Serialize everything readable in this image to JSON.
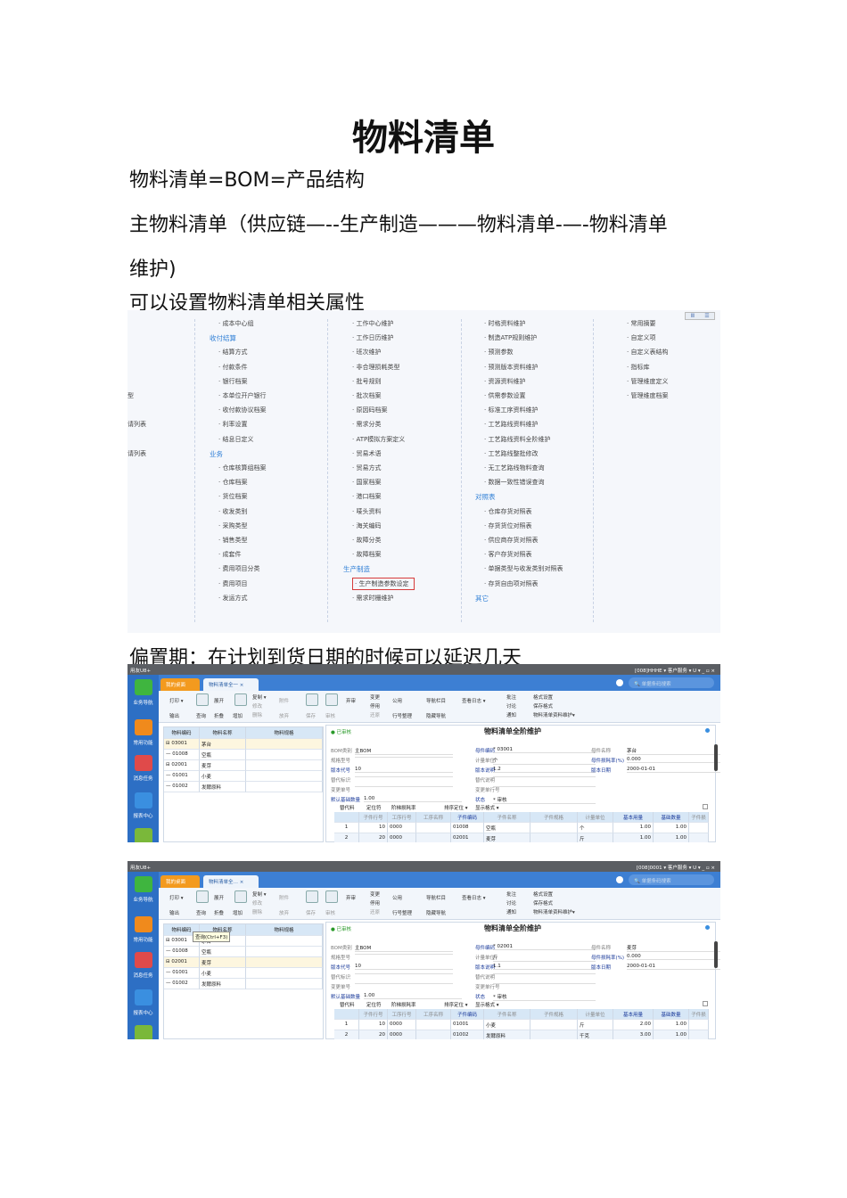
{
  "title": "物料清单",
  "paragraphs": [
    "物料清单=BOM=产品结构",
    "主物料清单（供应链—--生产制造———物料清单-—-物料清单",
    "维护)",
    "可以设置物料清单相关属性",
    "偏置期：在计划到货日期的时候可以延迟几天"
  ],
  "menu": {
    "view_toggle": [
      "Ⅲ",
      "☰"
    ],
    "columns": [
      {
        "items": [
          {
            "row": 5,
            "text": "型"
          },
          {
            "row": 7,
            "text": "请列表"
          },
          {
            "row": 9,
            "text": "请列表"
          }
        ]
      },
      {
        "items": [
          {
            "text": "成本中心组"
          },
          {
            "text": "收付结算",
            "header": true
          },
          {
            "text": "结算方式"
          },
          {
            "text": "付款条件"
          },
          {
            "text": "银行档案"
          },
          {
            "text": "本单位开户银行"
          },
          {
            "text": "收付款协议档案"
          },
          {
            "text": "利率设置"
          },
          {
            "text": "结息日定义"
          },
          {
            "text": "业务",
            "header": true
          },
          {
            "text": "仓库核算组档案"
          },
          {
            "text": "仓库档案"
          },
          {
            "text": "货位档案"
          },
          {
            "text": "收发类别"
          },
          {
            "text": "采购类型"
          },
          {
            "text": "销售类型"
          },
          {
            "text": "成套件"
          },
          {
            "text": "费用项目分类"
          },
          {
            "text": "费用项目"
          },
          {
            "text": "发运方式"
          }
        ]
      },
      {
        "items": [
          {
            "text": "工作中心维护"
          },
          {
            "text": "工作日历维护"
          },
          {
            "text": "班次维护"
          },
          {
            "text": "非合理损耗类型"
          },
          {
            "text": "批号规则"
          },
          {
            "text": "批次档案"
          },
          {
            "text": "原因码档案"
          },
          {
            "text": "需求分类"
          },
          {
            "text": "ATP模拟方案定义"
          },
          {
            "text": "贸易术语"
          },
          {
            "text": "贸易方式"
          },
          {
            "text": "国家档案"
          },
          {
            "text": "港口档案"
          },
          {
            "text": "唛头资料"
          },
          {
            "text": "海关编码"
          },
          {
            "text": "故障分类"
          },
          {
            "text": "故障档案"
          },
          {
            "text": "生产制造",
            "header": true
          },
          {
            "text": "生产制造参数设定",
            "highlighted": true
          },
          {
            "text": "需求时栅维护"
          }
        ]
      },
      {
        "items": [
          {
            "text": "时格资料维护"
          },
          {
            "text": "制造ATP规则维护"
          },
          {
            "text": "预测参数"
          },
          {
            "text": "预测版本资料维护"
          },
          {
            "text": "资源资料维护"
          },
          {
            "text": "供需参数设置"
          },
          {
            "text": "标准工序资料维护"
          },
          {
            "text": "工艺路线资料维护"
          },
          {
            "text": "工艺路线资料全阶维护"
          },
          {
            "text": "工艺路线整批修改"
          },
          {
            "text": "无工艺路线物料查询"
          },
          {
            "text": "数据一致性错误查询"
          },
          {
            "text": "对照表",
            "header": true
          },
          {
            "text": "仓库存货对照表"
          },
          {
            "text": "存货货位对照表"
          },
          {
            "text": "供应商存货对照表"
          },
          {
            "text": "客户存货对照表"
          },
          {
            "text": "单据类型与收发类别对照表"
          },
          {
            "text": "存货自由项对照表"
          },
          {
            "text": "其它",
            "header": true
          }
        ]
      },
      {
        "items": [
          {
            "text": "常用摘要"
          },
          {
            "text": "自定义项"
          },
          {
            "text": "自定义表结构"
          },
          {
            "text": "指标库"
          },
          {
            "text": "管理维度定义"
          },
          {
            "text": "管理维度档案"
          }
        ]
      }
    ]
  },
  "apps": [
    {
      "app_name": "用友U8+",
      "title_right": "[008]HHHE  ▾  客户服务 ▾  U  ▾  _  ▫  ×",
      "tabs": [
        "我的桌面",
        "物料清单全一 ×"
      ],
      "search_placeholder": "单据条码搜索",
      "sidebar": [
        "业务导航",
        "常用功能",
        "消息任务",
        "报表中心"
      ],
      "toolbar": [
        "打印 ▾",
        "输出",
        "查询",
        "展开",
        "折叠",
        "增加",
        "复制 ▾",
        "修改",
        "删除",
        "附件",
        "放弃",
        "保存",
        "审核",
        "弃审",
        "变更",
        "停用",
        "还原",
        "公用",
        "行号整理",
        "导航栏目",
        "查看日志 ▾",
        "隐藏导航",
        "批注",
        "讨论",
        "通知",
        "格式设置",
        "保存格式",
        "物料清单资料维护▾"
      ],
      "tree_headers": [
        "物料编码",
        "物料名称",
        "物料规格"
      ],
      "tree_rows": [
        [
          "⊟ 03001",
          "茅台"
        ],
        [
          "— 01008",
          "空瓶"
        ],
        [
          "⊟ 02001",
          "麦芽"
        ],
        [
          "— 01001",
          "小麦"
        ],
        [
          "— 01002",
          "发酵原料"
        ]
      ],
      "tooltip": "",
      "status": "● 已审核",
      "form_title": "物料清单全阶维护",
      "form": [
        [
          "BOM类别",
          "主BOM"
        ],
        [
          "规格型号",
          ""
        ],
        [
          "版本代号",
          "10"
        ],
        [
          "替代标识",
          ""
        ],
        [
          "变更单号",
          ""
        ],
        [
          "默认基础数量",
          "1.00"
        ],
        [
          "母件编码",
          "* 03001"
        ],
        [
          "计量单位",
          "个"
        ],
        [
          "版本说明",
          "1.2"
        ],
        [
          "替代说明",
          ""
        ],
        [
          "变更单行号",
          ""
        ],
        [
          "状态",
          "* 审核"
        ],
        [
          "母件名称",
          "茅台"
        ],
        [
          "母件损耗率(%)",
          "0.000"
        ],
        [
          "版本日期",
          "2000-01-01"
        ]
      ],
      "grid_tabs": [
        "替代料",
        "定位符",
        "阶梯损耗率",
        "排序定位 ▾",
        "显示格式 ▾"
      ],
      "grid_headers": [
        "",
        "子件行号",
        "工序行号",
        "工序名称",
        "子件编码",
        "子件名称",
        "子件规格",
        "计量单位",
        "基本用量",
        "基础数量",
        "子件损"
      ],
      "grid_rows": [
        [
          "1",
          "10",
          "0000",
          "",
          "01008",
          "空瓶",
          "",
          "个",
          "1.00",
          "1.00",
          ""
        ],
        [
          "2",
          "20",
          "0000",
          "",
          "02001",
          "麦芽",
          "",
          "斤",
          "1.00",
          "1.00",
          ""
        ]
      ]
    },
    {
      "app_name": "用友U8+",
      "title_right": "[008]0001  ▾  客户服务 ▾  U  ▾  _  ▫  ×",
      "tabs": [
        "我的桌面",
        "物料清单全… ×"
      ],
      "search_placeholder": "单据条码搜索",
      "sidebar": [
        "业务导航",
        "常用功能",
        "消息任务",
        "报表中心"
      ],
      "toolbar": [
        "打印 ▾",
        "输出",
        "查询",
        "展开",
        "折叠",
        "增加",
        "复制 ▾",
        "修改",
        "删除",
        "附件",
        "放弃",
        "保存",
        "审核",
        "弃审",
        "变更",
        "停用",
        "还原",
        "公用",
        "行号整理",
        "导航栏目",
        "查看日志 ▾",
        "隐藏导航",
        "批注",
        "讨论",
        "通知",
        "格式设置",
        "保存格式",
        "物料清单资料维护▾"
      ],
      "tree_headers": [
        "物料编码",
        "物料名称",
        "物料规格"
      ],
      "tree_rows": [
        [
          "⊟ 03001",
          "茅台"
        ],
        [
          "— 01008",
          "空瓶"
        ],
        [
          "⊟ 02001",
          "麦芽"
        ],
        [
          "— 01001",
          "小麦"
        ],
        [
          "— 01002",
          "发酵原料"
        ]
      ],
      "tooltip": "查询(Ctrl+F3)",
      "status": "● 已审核",
      "form_title": "物料清单全阶维护",
      "form": [
        [
          "BOM类别",
          "主BOM"
        ],
        [
          "规格型号",
          ""
        ],
        [
          "版本代号",
          "10"
        ],
        [
          "替代标识",
          ""
        ],
        [
          "变更单号",
          ""
        ],
        [
          "默认基础数量",
          "1.00"
        ],
        [
          "母件编码",
          "* 02001"
        ],
        [
          "计量单位",
          "斤"
        ],
        [
          "版本说明",
          "1.1"
        ],
        [
          "替代说明",
          ""
        ],
        [
          "变更单行号",
          ""
        ],
        [
          "状态",
          "* 审核"
        ],
        [
          "母件名称",
          "麦芽"
        ],
        [
          "母件损耗率(%)",
          "0.000"
        ],
        [
          "版本日期",
          "2000-01-01"
        ]
      ],
      "grid_tabs": [
        "替代料",
        "定位符",
        "阶梯损耗率",
        "排序定位 ▾",
        "显示格式 ▾"
      ],
      "grid_headers": [
        "",
        "子件行号",
        "工序行号",
        "工序名称",
        "子件编码",
        "子件名称",
        "子件规格",
        "计量单位",
        "基本用量",
        "基础数量",
        "子件损"
      ],
      "grid_rows": [
        [
          "1",
          "10",
          "0000",
          "",
          "01001",
          "小麦",
          "",
          "斤",
          "2.00",
          "1.00",
          ""
        ],
        [
          "2",
          "20",
          "0000",
          "",
          "01002",
          "发酵原料",
          "",
          "千克",
          "3.00",
          "1.00",
          ""
        ]
      ]
    }
  ]
}
